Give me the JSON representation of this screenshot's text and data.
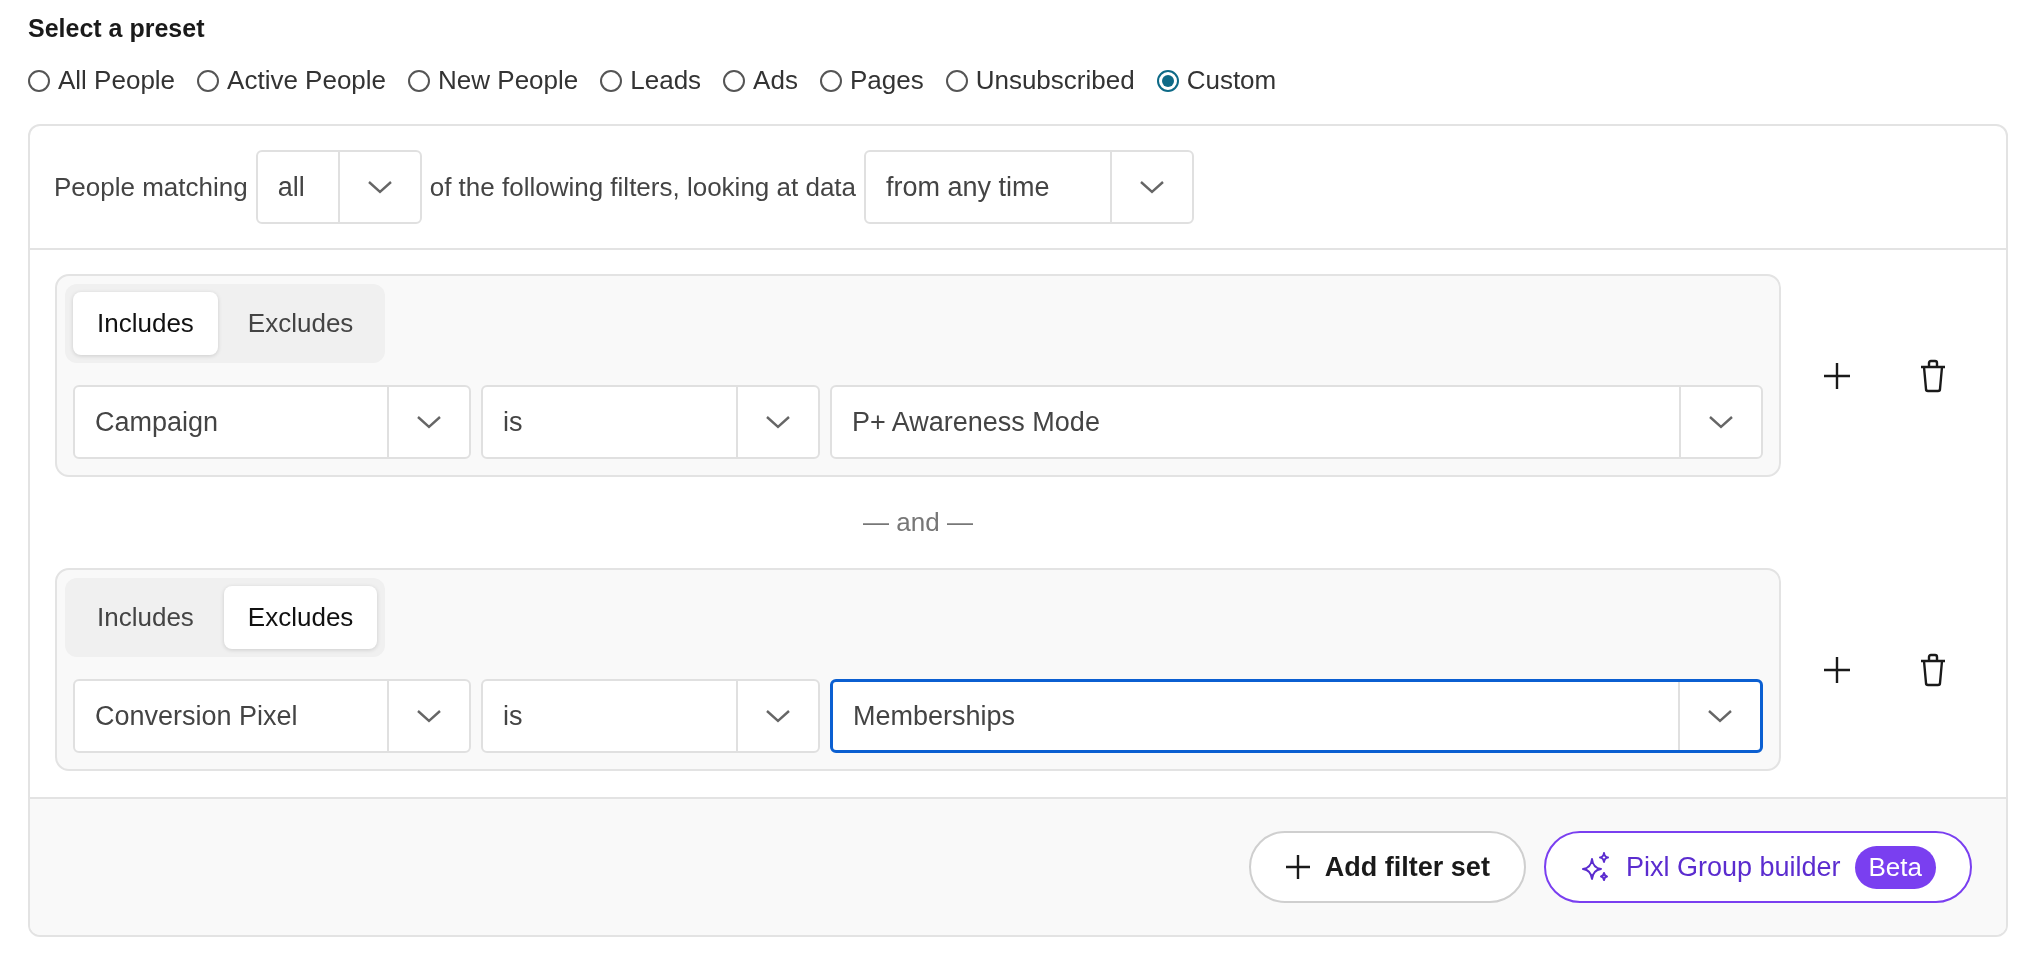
{
  "heading": "Select a preset",
  "presets": [
    {
      "label": "All People",
      "selected": false
    },
    {
      "label": "Active People",
      "selected": false
    },
    {
      "label": "New People",
      "selected": false
    },
    {
      "label": "Leads",
      "selected": false
    },
    {
      "label": "Ads",
      "selected": false
    },
    {
      "label": "Pages",
      "selected": false
    },
    {
      "label": "Unsubscribed",
      "selected": false
    },
    {
      "label": "Custom",
      "selected": true
    }
  ],
  "matching": {
    "prefix": "People matching",
    "match_value": "all",
    "middle": "of the following filters, looking at data",
    "time_value": "from any time"
  },
  "filter_sets": [
    {
      "tabs": [
        {
          "label": "Includes",
          "selected": true
        },
        {
          "label": "Excludes",
          "selected": false
        }
      ],
      "field": "Campaign",
      "operator": "is",
      "value": "P+ Awareness Mode",
      "focused": false
    },
    {
      "tabs": [
        {
          "label": "Includes",
          "selected": false
        },
        {
          "label": "Excludes",
          "selected": true
        }
      ],
      "field": "Conversion Pixel",
      "operator": "is",
      "value": "Memberships",
      "focused": true
    }
  ],
  "joiner": "— and —",
  "footer": {
    "add_label": "Add filter set",
    "builder_label": "Pixl Group builder",
    "builder_badge": "Beta"
  }
}
